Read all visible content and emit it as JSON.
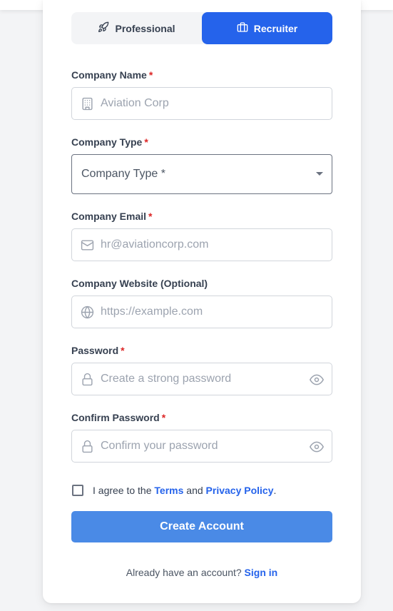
{
  "tabs": [
    {
      "label": "Professional",
      "icon": "rocket-icon",
      "active": false
    },
    {
      "label": "Recruiter",
      "icon": "briefcase-icon",
      "active": true
    }
  ],
  "fields": {
    "company_name": {
      "label": "Company Name",
      "required": "*",
      "placeholder": "Aviation Corp"
    },
    "company_type": {
      "label": "Company Type",
      "required": "*",
      "selected": "Company Type *"
    },
    "company_email": {
      "label": "Company Email",
      "required": "*",
      "placeholder": "hr@aviationcorp.com"
    },
    "company_website": {
      "label": "Company Website (Optional)",
      "placeholder": "https://example.com"
    },
    "password": {
      "label": "Password",
      "required": "*",
      "placeholder": "Create a strong password"
    },
    "confirm_password": {
      "label": "Confirm Password",
      "required": "*",
      "placeholder": "Confirm your password"
    }
  },
  "agreement": {
    "prefix": "I agree to the ",
    "terms": "Terms",
    "and": " and ",
    "privacy": "Privacy Policy",
    "suffix": "."
  },
  "submit_label": "Create Account",
  "signin": {
    "prompt": "Already have an account? ",
    "link": "Sign in"
  },
  "colors": {
    "accent": "#2563eb",
    "button": "#4a8ae6",
    "required": "#dc2626"
  }
}
